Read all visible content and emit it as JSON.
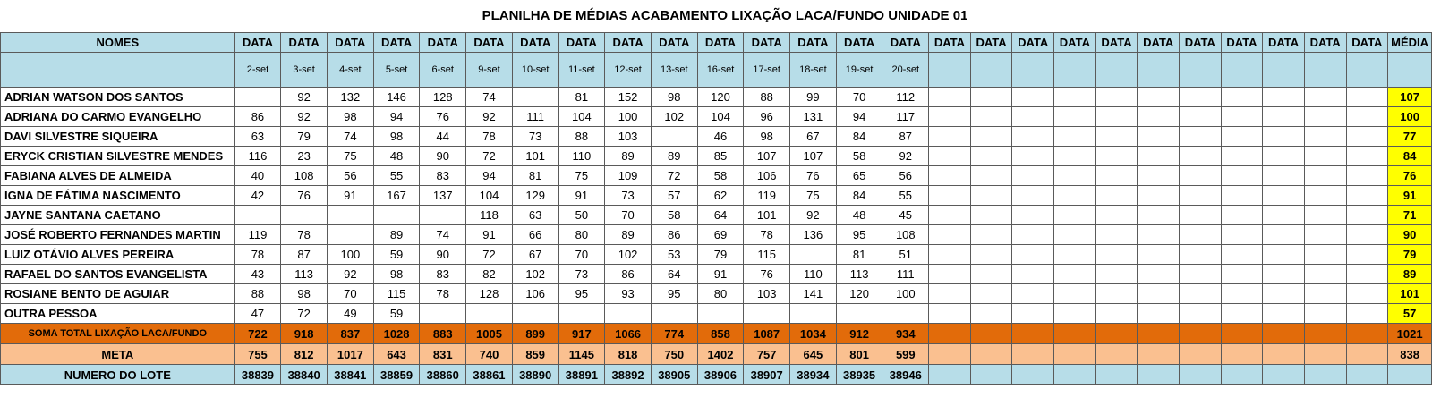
{
  "title": "PLANILHA DE MÉDIAS ACABAMENTO LIXAÇÃO LACA/FUNDO UNIDADE 01",
  "header": {
    "names_label": "NOMES",
    "data_label": "DATA",
    "media_label": "MÉDIA",
    "filled_dates": [
      "2-set",
      "3-set",
      "4-set",
      "5-set",
      "6-set",
      "9-set",
      "10-set",
      "11-set",
      "12-set",
      "13-set",
      "16-set",
      "17-set",
      "18-set",
      "19-set",
      "20-set"
    ],
    "empty_date_columns": 11
  },
  "rows": [
    {
      "name": "ADRIAN WATSON DOS SANTOS",
      "values": [
        "",
        "92",
        "132",
        "146",
        "128",
        "74",
        "",
        "81",
        "152",
        "98",
        "120",
        "88",
        "99",
        "70",
        "112"
      ],
      "media": "107"
    },
    {
      "name": "ADRIANA DO CARMO EVANGELHO",
      "values": [
        "86",
        "92",
        "98",
        "94",
        "76",
        "92",
        "111",
        "104",
        "100",
        "102",
        "104",
        "96",
        "131",
        "94",
        "117"
      ],
      "media": "100"
    },
    {
      "name": "DAVI SILVESTRE SIQUEIRA",
      "values": [
        "63",
        "79",
        "74",
        "98",
        "44",
        "78",
        "73",
        "88",
        "103",
        "",
        "46",
        "98",
        "67",
        "84",
        "87"
      ],
      "media": "77"
    },
    {
      "name": "ERYCK CRISTIAN SILVESTRE MENDES",
      "values": [
        "116",
        "23",
        "75",
        "48",
        "90",
        "72",
        "101",
        "110",
        "89",
        "89",
        "85",
        "107",
        "107",
        "58",
        "92"
      ],
      "media": "84"
    },
    {
      "name": "FABIANA ALVES DE ALMEIDA",
      "values": [
        "40",
        "108",
        "56",
        "55",
        "83",
        "94",
        "81",
        "75",
        "109",
        "72",
        "58",
        "106",
        "76",
        "65",
        "56"
      ],
      "media": "76"
    },
    {
      "name": "IGNA DE FÁTIMA NASCIMENTO",
      "values": [
        "42",
        "76",
        "91",
        "167",
        "137",
        "104",
        "129",
        "91",
        "73",
        "57",
        "62",
        "119",
        "75",
        "84",
        "55"
      ],
      "media": "91"
    },
    {
      "name": "JAYNE SANTANA CAETANO",
      "values": [
        "",
        "",
        "",
        "",
        "",
        "118",
        "63",
        "50",
        "70",
        "58",
        "64",
        "101",
        "92",
        "48",
        "45"
      ],
      "media": "71"
    },
    {
      "name": "JOSÉ ROBERTO FERNANDES MARTIN",
      "values": [
        "119",
        "78",
        "",
        "89",
        "74",
        "91",
        "66",
        "80",
        "89",
        "86",
        "69",
        "78",
        "136",
        "95",
        "108"
      ],
      "media": "90"
    },
    {
      "name": "LUIZ OTÁVIO ALVES PEREIRA",
      "values": [
        "78",
        "87",
        "100",
        "59",
        "90",
        "72",
        "67",
        "70",
        "102",
        "53",
        "79",
        "115",
        "",
        "81",
        "51"
      ],
      "media": "79"
    },
    {
      "name": "RAFAEL DO SANTOS EVANGELISTA",
      "values": [
        "43",
        "113",
        "92",
        "98",
        "83",
        "82",
        "102",
        "73",
        "86",
        "64",
        "91",
        "76",
        "110",
        "113",
        "111"
      ],
      "media": "89"
    },
    {
      "name": "ROSIANE BENTO DE AGUIAR",
      "values": [
        "88",
        "98",
        "70",
        "115",
        "78",
        "128",
        "106",
        "95",
        "93",
        "95",
        "80",
        "103",
        "141",
        "120",
        "100"
      ],
      "media": "101"
    },
    {
      "name": "OUTRA PESSOA",
      "values": [
        "47",
        "72",
        "49",
        "59",
        "",
        "",
        "",
        "",
        "",
        "",
        "",
        "",
        "",
        "",
        ""
      ],
      "media": "57"
    }
  ],
  "total": {
    "label": "SOMA TOTAL LIXAÇÃO LACA/FUNDO",
    "values": [
      "722",
      "918",
      "837",
      "1028",
      "883",
      "1005",
      "899",
      "917",
      "1066",
      "774",
      "858",
      "1087",
      "1034",
      "912",
      "934"
    ],
    "media": "1021"
  },
  "meta": {
    "label": "META",
    "values": [
      "755",
      "812",
      "1017",
      "643",
      "831",
      "740",
      "859",
      "1145",
      "818",
      "750",
      "1402",
      "757",
      "645",
      "801",
      "599"
    ],
    "media": "838"
  },
  "lote": {
    "label": "NUMERO DO LOTE",
    "values": [
      "38839",
      "38840",
      "38841",
      "38859",
      "38860",
      "38861",
      "38890",
      "38891",
      "38892",
      "38905",
      "38906",
      "38907",
      "38934",
      "38935",
      "38946"
    ],
    "media": ""
  },
  "colors": {
    "header_bg": "#b7dde8",
    "total_bg": "#e26b0a",
    "meta_bg": "#fac090",
    "media_highlight": "#ffff00"
  }
}
